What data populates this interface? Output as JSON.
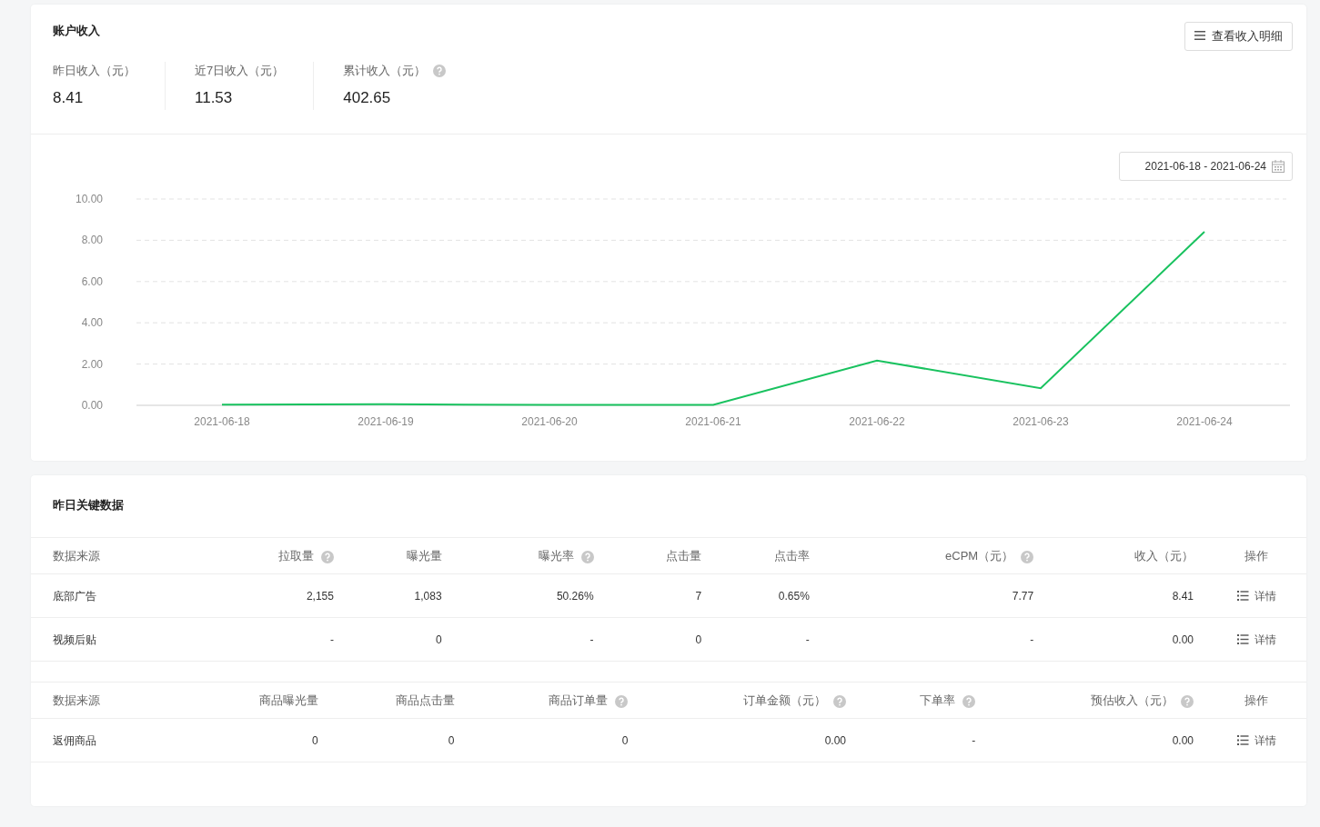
{
  "income": {
    "title": "账户收入",
    "detail_button": "查看收入明细",
    "stats": [
      {
        "label": "昨日收入（元）",
        "value": "8.41",
        "help": false
      },
      {
        "label": "近7日收入（元）",
        "value": "11.53",
        "help": false
      },
      {
        "label": "累计收入（元）",
        "value": "402.65",
        "help": true
      }
    ],
    "date_range": "2021-06-18 - 2021-06-24",
    "chart_data": {
      "type": "line",
      "categories": [
        "2021-06-18",
        "2021-06-19",
        "2021-06-20",
        "2021-06-21",
        "2021-06-22",
        "2021-06-23",
        "2021-06-24"
      ],
      "grid": true,
      "series": [
        {
          "color": "#19c25f",
          "values": [
            0.03,
            0.05,
            0.02,
            0.02,
            2.17,
            0.83,
            8.41
          ]
        }
      ],
      "ylim": [
        0,
        10
      ],
      "yticks": [
        {
          "value": 0,
          "label": "0.00"
        },
        {
          "value": 2,
          "label": "2.00"
        },
        {
          "value": 4,
          "label": "4.00"
        },
        {
          "value": 6,
          "label": "6.00"
        },
        {
          "value": 8,
          "label": "8.00"
        },
        {
          "value": 10,
          "label": "10.00"
        }
      ]
    }
  },
  "key_data": {
    "title": "昨日关键数据",
    "tables": [
      {
        "columns": [
          {
            "label": "数据来源",
            "help": false
          },
          {
            "label": "拉取量",
            "help": true
          },
          {
            "label": "曝光量",
            "help": false
          },
          {
            "label": "曝光率",
            "help": true
          },
          {
            "label": "点击量",
            "help": false
          },
          {
            "label": "点击率",
            "help": false
          },
          {
            "label": "eCPM（元）",
            "help": true
          },
          {
            "label": "收入（元）",
            "help": false
          },
          {
            "label": "操作",
            "help": false
          }
        ],
        "rows": [
          {
            "cells": [
              "底部广告",
              "2,155",
              "1,083",
              "50.26%",
              "7",
              "0.65%",
              "7.77",
              "8.41"
            ],
            "action": "详情"
          },
          {
            "cells": [
              "视频后贴",
              "-",
              "0",
              "-",
              "0",
              "-",
              "-",
              "0.00"
            ],
            "action": "详情"
          }
        ]
      },
      {
        "columns": [
          {
            "label": "数据来源",
            "help": false
          },
          {
            "label": "商品曝光量",
            "help": false
          },
          {
            "label": "商品点击量",
            "help": false
          },
          {
            "label": "商品订单量",
            "help": true
          },
          {
            "label": "订单金额（元）",
            "help": true
          },
          {
            "label": "下单率",
            "help": true
          },
          {
            "label": "预估收入（元）",
            "help": true
          },
          {
            "label": "操作",
            "help": false
          }
        ],
        "rows": [
          {
            "cells": [
              "返佣商品",
              "0",
              "0",
              "0",
              "0.00",
              "-",
              "0.00"
            ],
            "action": "详情"
          }
        ]
      }
    ]
  }
}
